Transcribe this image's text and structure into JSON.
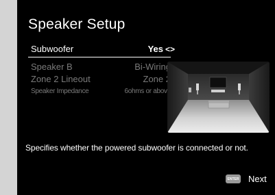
{
  "screen": {
    "title": "Speaker Setup",
    "menu": [
      {
        "label": "Subwoofer",
        "value": "Yes",
        "arrows": "<>"
      },
      {
        "label": "Speaker B",
        "value": "Bi-Wiring"
      },
      {
        "label": "Zone 2 Lineout",
        "value": "Zone 2"
      },
      {
        "label": "Speaker Impedance",
        "value": "6ohms or above"
      }
    ],
    "description": "Specifies whether the powered subwoofer is connected or not.",
    "footer": {
      "enter_label": "ENTER",
      "next_label": "Next"
    }
  },
  "colors": {
    "screen_bg": "#000000",
    "side_panel": "#d4d4d4",
    "text_active": "#ffffff",
    "text_dim": "#7a7a7a"
  }
}
